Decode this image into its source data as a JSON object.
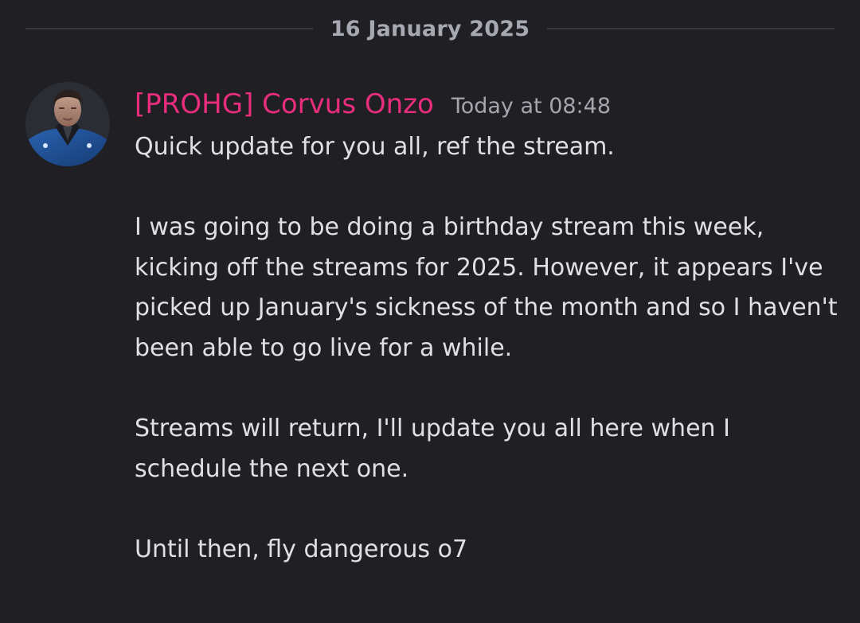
{
  "date_divider": {
    "label": "16 January 2025"
  },
  "message": {
    "author": "[PROHG] Corvus Onzo",
    "timestamp": "Today at 08:48",
    "author_color": "#e82d7d",
    "avatar_icon": "user-avatar-icon",
    "paragraphs": [
      "Quick update for you all, ref the stream.",
      "I was going to be doing a birthday stream this week, kicking off the streams for 2025. However, it appears I've picked up January's sickness of the month and so I haven't been able to go live for a while.",
      "Streams will return, I'll update you all here when I schedule the next one.",
      "Until then, fly dangerous o7"
    ]
  }
}
